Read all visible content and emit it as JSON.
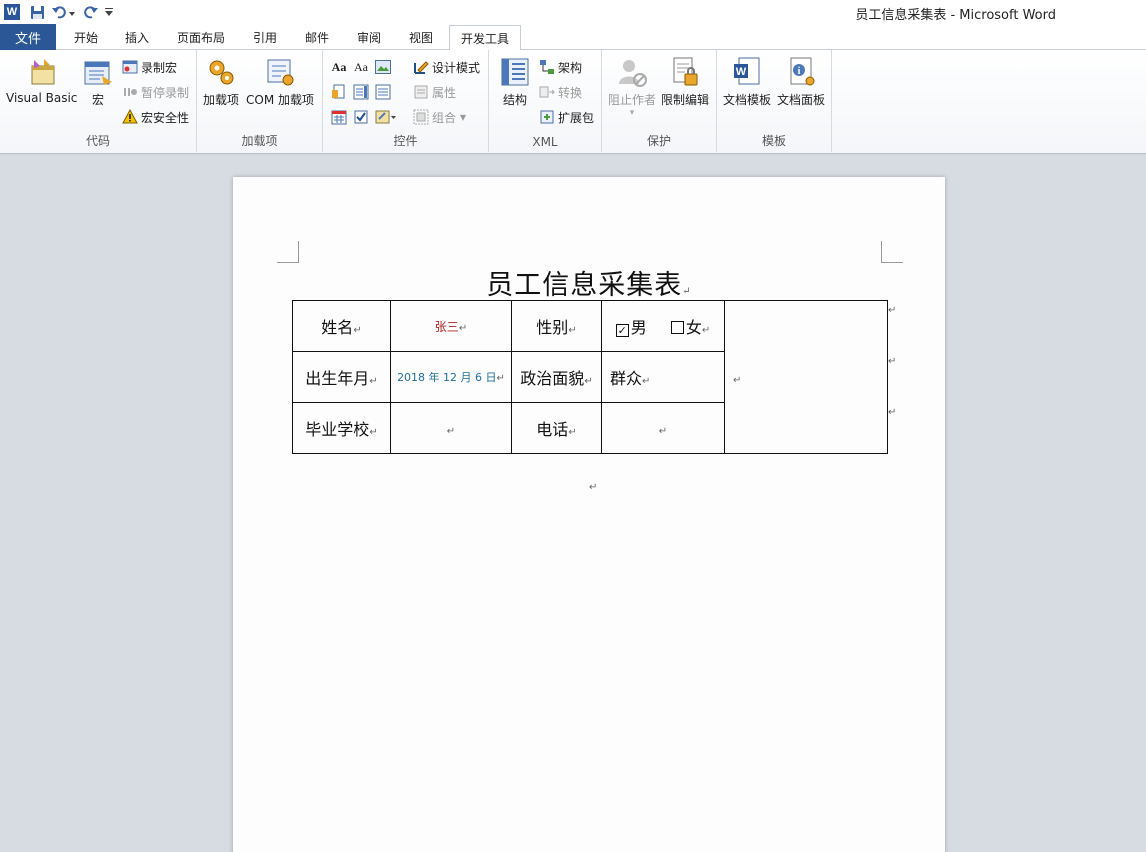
{
  "window": {
    "title": "员工信息采集表 - Microsoft Word",
    "app_icon": "W"
  },
  "tabs": {
    "file": "文件",
    "items": [
      "开始",
      "插入",
      "页面布局",
      "引用",
      "邮件",
      "审阅",
      "视图",
      "开发工具"
    ],
    "active": "开发工具"
  },
  "ribbon": {
    "code": {
      "label": "代码",
      "visual_basic": "Visual Basic",
      "macros": "宏",
      "record_macro": "录制宏",
      "pause_recording": "暂停录制",
      "macro_security": "宏安全性"
    },
    "addins": {
      "label": "加载项",
      "addins": "加载项",
      "com_addins": "COM 加载项"
    },
    "controls": {
      "label": "控件",
      "design_mode": "设计模式",
      "properties": "属性",
      "group": "组合"
    },
    "xml": {
      "label": "XML",
      "structure": "结构",
      "schema": "架构",
      "transform": "转换",
      "expansion_packs": "扩展包"
    },
    "protect": {
      "label": "保护",
      "block_authors": "阻止作者",
      "restrict_editing": "限制编辑"
    },
    "templates": {
      "label": "模板",
      "document_template": "文档模板",
      "document_panel": "文档面板"
    }
  },
  "document": {
    "title": "员工信息采集表",
    "paragraph_mark": "↵",
    "table": {
      "name_label": "姓名",
      "name_value": "张三",
      "gender_label": "性别",
      "gender_male": "男",
      "gender_female": "女",
      "gender_male_checked": true,
      "gender_female_checked": false,
      "birth_label": "出生年月",
      "birth_value": "2018 年 12 月 6 日",
      "politics_label": "政治面貌",
      "politics_value": "群众",
      "school_label": "毕业学校",
      "school_value": "",
      "phone_label": "电话",
      "phone_value": ""
    }
  },
  "colors": {
    "file_tab": "#2b5797",
    "name_value": "#b22222",
    "date_value": "#1f6f9a"
  }
}
